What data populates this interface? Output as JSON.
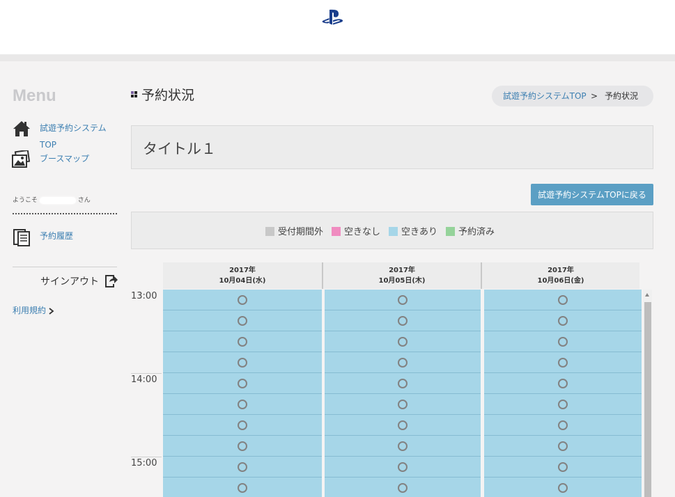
{
  "header": {
    "logo_icon": "playstation-logo-icon"
  },
  "sidebar": {
    "menu_title": "Menu",
    "top_link_line1": "試遊予約システム",
    "top_link_line2": "TOP",
    "booth_map": "ブースマップ",
    "welcome_prefix": "ようこそ",
    "welcome_suffix": "さん",
    "history": "予約履歴",
    "signout": "サインアウト",
    "terms": "利用規約"
  },
  "page": {
    "title": "予約状況",
    "breadcrumb": {
      "link": "試遊予約システムTOP",
      "separator": ">",
      "current": "予約状況"
    },
    "box_title": "タイトル１",
    "back_button": "試遊予約システムTOPに戻る"
  },
  "legend": [
    {
      "label": "受付期間外",
      "color": "#c8c8c8"
    },
    {
      "label": "空きなし",
      "color": "#f08cc0"
    },
    {
      "label": "空きあり",
      "color": "#a6d6e8"
    },
    {
      "label": "予約済み",
      "color": "#95d39a"
    }
  ],
  "calendar": {
    "columns": [
      {
        "year": "2017年",
        "date": "10月04日(水)"
      },
      {
        "year": "2017年",
        "date": "10月05日(木)"
      },
      {
        "year": "2017年",
        "date": "10月06日(金)"
      }
    ],
    "time_labels": [
      "13:00",
      "14:00",
      "15:00"
    ],
    "slot_symbol_icon": "circle-available-icon",
    "rows": 10,
    "status": "空きあり"
  }
}
